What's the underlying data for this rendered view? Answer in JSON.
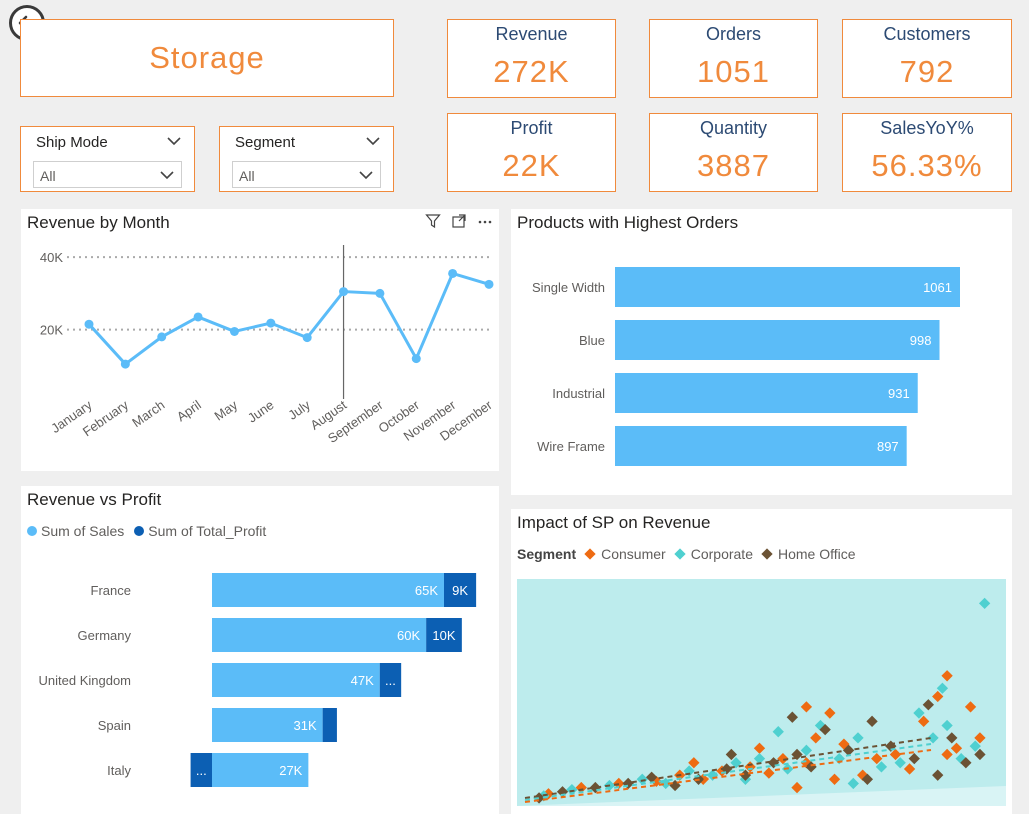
{
  "page": {
    "title": "Storage"
  },
  "slicers": [
    {
      "label": "Ship Mode",
      "value": "All"
    },
    {
      "label": "Segment",
      "value": "All"
    }
  ],
  "kpis": {
    "revenue": {
      "label": "Revenue",
      "value": "272K"
    },
    "orders": {
      "label": "Orders",
      "value": "1051"
    },
    "customers": {
      "label": "Customers",
      "value": "792"
    },
    "profit": {
      "label": "Profit",
      "value": "22K"
    },
    "quantity": {
      "label": "Quantity",
      "value": "3887"
    },
    "sales_yoy": {
      "label": "SalesYoY%",
      "value": "56.33%"
    }
  },
  "icons": [
    "back-arrow-icon",
    "filter-icon",
    "focus-mode-icon",
    "more-options-icon"
  ],
  "colors": {
    "accent": "#f08a3c",
    "kpi_label": "#2c4a73",
    "bar_light": "#5bbcf8",
    "bar_dark": "#0c5fb3",
    "consumer": "#ee6b12",
    "corporate": "#4fd0d0",
    "home_office": "#6b5234",
    "scatter_bg": "#bdeced"
  },
  "charts": {
    "revenue_by_month": {
      "title": "Revenue by Month"
    },
    "products": {
      "title": "Products with Highest Orders"
    },
    "rev_vs_profit": {
      "title": "Revenue vs Profit",
      "legend": [
        "Sum of Sales",
        "Sum of Total_Profit"
      ]
    },
    "impact": {
      "title": "Impact of SP on Revenue",
      "legend_title": "Segment",
      "legend": [
        "Consumer",
        "Corporate",
        "Home Office"
      ]
    }
  },
  "chart_data": [
    {
      "type": "line",
      "title": "Revenue by Month",
      "categories": [
        "January",
        "February",
        "March",
        "April",
        "May",
        "June",
        "July",
        "August",
        "September",
        "October",
        "November",
        "December"
      ],
      "values": [
        21500,
        10500,
        18000,
        23500,
        19500,
        21800,
        17800,
        30500,
        30000,
        12000,
        35500,
        32500
      ],
      "yticks": [
        "20K",
        "40K"
      ],
      "ylim": [
        5000,
        45000
      ],
      "grid": true,
      "reference_line_x": "August"
    },
    {
      "type": "bar",
      "orientation": "horizontal",
      "title": "Products with Highest Orders",
      "categories": [
        "Single Width",
        "Blue",
        "Industrial",
        "Wire Frame"
      ],
      "values": [
        1061,
        998,
        931,
        897
      ],
      "xlim": [
        0,
        1061
      ]
    },
    {
      "type": "bar",
      "orientation": "horizontal",
      "stacked": true,
      "title": "Revenue vs Profit",
      "categories": [
        "France",
        "Germany",
        "United Kingdom",
        "Spain",
        "Italy"
      ],
      "series": [
        {
          "name": "Sum of Sales",
          "values": [
            65000,
            60000,
            47000,
            31000,
            27000
          ],
          "labels": [
            "65K",
            "60K",
            "47K",
            "31K",
            "27K"
          ]
        },
        {
          "name": "Sum of Total_Profit",
          "values": [
            9000,
            10000,
            6000,
            4000,
            -6000
          ],
          "labels": [
            "9K",
            "10K",
            "...",
            "",
            "..."
          ]
        }
      ]
    },
    {
      "type": "scatter",
      "title": "Impact of SP on Revenue",
      "legend_title": "Segment",
      "series": [
        {
          "name": "Consumer",
          "points": [
            [
              0.05,
              0.03
            ],
            [
              0.12,
              0.06
            ],
            [
              0.2,
              0.08
            ],
            [
              0.28,
              0.09
            ],
            [
              0.33,
              0.12
            ],
            [
              0.38,
              0.1
            ],
            [
              0.42,
              0.14
            ],
            [
              0.48,
              0.16
            ],
            [
              0.52,
              0.13
            ],
            [
              0.55,
              0.2
            ],
            [
              0.6,
              0.18
            ],
            [
              0.62,
              0.3
            ],
            [
              0.65,
              0.42
            ],
            [
              0.68,
              0.27
            ],
            [
              0.72,
              0.12
            ],
            [
              0.75,
              0.2
            ],
            [
              0.82,
              0.15
            ],
            [
              0.85,
              0.38
            ],
            [
              0.88,
              0.5
            ],
            [
              0.9,
              0.6
            ],
            [
              0.92,
              0.25
            ],
            [
              0.95,
              0.45
            ],
            [
              0.97,
              0.3
            ],
            [
              0.5,
              0.25
            ],
            [
              0.36,
              0.18
            ],
            [
              0.6,
              0.45
            ],
            [
              0.9,
              0.22
            ],
            [
              0.58,
              0.06
            ],
            [
              0.66,
              0.1
            ],
            [
              0.79,
              0.22
            ]
          ]
        },
        {
          "name": "Corporate",
          "points": [
            [
              0.04,
              0.02
            ],
            [
              0.1,
              0.05
            ],
            [
              0.18,
              0.07
            ],
            [
              0.25,
              0.1
            ],
            [
              0.3,
              0.08
            ],
            [
              0.35,
              0.14
            ],
            [
              0.4,
              0.12
            ],
            [
              0.45,
              0.18
            ],
            [
              0.5,
              0.2
            ],
            [
              0.56,
              0.15
            ],
            [
              0.6,
              0.24
            ],
            [
              0.63,
              0.36
            ],
            [
              0.67,
              0.2
            ],
            [
              0.71,
              0.3
            ],
            [
              0.76,
              0.16
            ],
            [
              0.8,
              0.18
            ],
            [
              0.84,
              0.42
            ],
            [
              0.87,
              0.3
            ],
            [
              0.9,
              0.36
            ],
            [
              0.93,
              0.2
            ],
            [
              0.96,
              0.26
            ],
            [
              0.98,
              0.95
            ],
            [
              0.47,
              0.1
            ],
            [
              0.54,
              0.33
            ],
            [
              0.7,
              0.08
            ],
            [
              0.89,
              0.54
            ]
          ]
        },
        {
          "name": "Home Office",
          "points": [
            [
              0.03,
              0.01
            ],
            [
              0.08,
              0.04
            ],
            [
              0.15,
              0.06
            ],
            [
              0.22,
              0.08
            ],
            [
              0.27,
              0.11
            ],
            [
              0.32,
              0.07
            ],
            [
              0.37,
              0.1
            ],
            [
              0.43,
              0.15
            ],
            [
              0.47,
              0.12
            ],
            [
              0.53,
              0.18
            ],
            [
              0.58,
              0.22
            ],
            [
              0.61,
              0.16
            ],
            [
              0.64,
              0.34
            ],
            [
              0.69,
              0.24
            ],
            [
              0.73,
              0.1
            ],
            [
              0.78,
              0.26
            ],
            [
              0.83,
              0.2
            ],
            [
              0.86,
              0.46
            ],
            [
              0.91,
              0.3
            ],
            [
              0.94,
              0.18
            ],
            [
              0.97,
              0.22
            ],
            [
              0.44,
              0.22
            ],
            [
              0.57,
              0.4
            ],
            [
              0.74,
              0.38
            ],
            [
              0.88,
              0.12
            ]
          ]
        }
      ],
      "trendlines": true
    }
  ]
}
